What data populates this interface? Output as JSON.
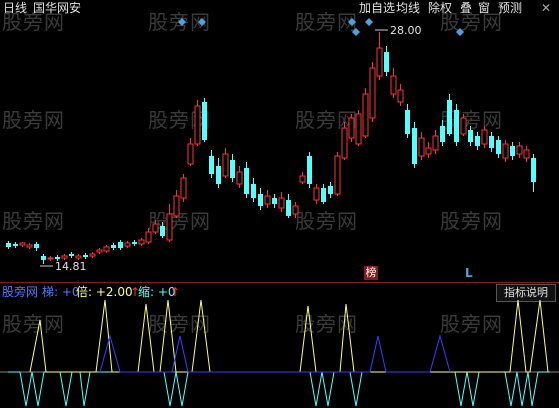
{
  "toolbar": {
    "period": "日线",
    "stock_name": "国华网安",
    "menu": [
      "加自选",
      "均线",
      "除权",
      "叠",
      "窗",
      "预测"
    ]
  },
  "watermark": "股旁网",
  "main_chart": {
    "high_label": "28.00",
    "low_label": "14.81",
    "marker_bang": "榜",
    "marker_L": "L",
    "colors": {
      "up": "#ff3232",
      "down": "#54ffff",
      "marker": "#4aa3df"
    }
  },
  "indicator": {
    "name": "股旁网",
    "ti_label": "梯: +0",
    "bei_label": "倍: +2.00",
    "bei_arrow": "↑",
    "suo_label": "缩: +0",
    "suo_arrow": "↑",
    "button": "指标说明",
    "colors": {
      "yellow": "#ffff80",
      "blue": "#3c3cff",
      "cyan": "#54ffff",
      "white": "#ffffff"
    }
  }
}
